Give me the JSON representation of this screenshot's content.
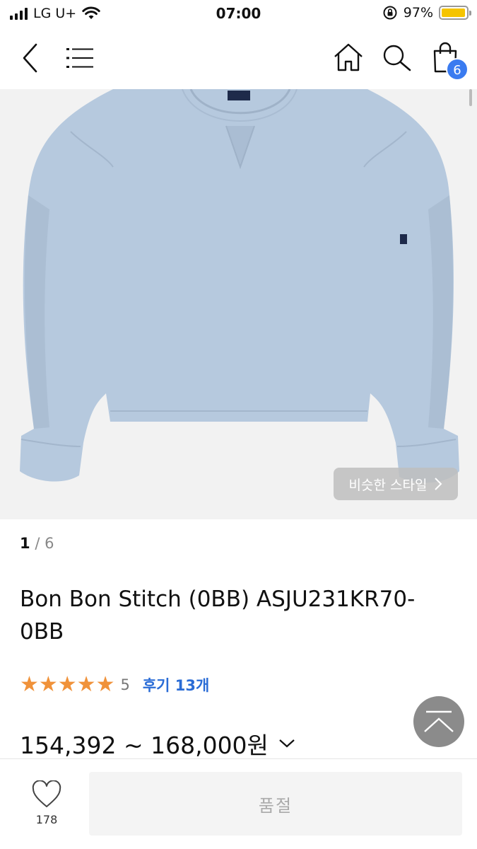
{
  "status": {
    "carrier": "LG U+",
    "time": "07:00",
    "battery": "97%",
    "battery_level": 0.97
  },
  "nav": {
    "back_icon": "chevron-left-icon",
    "menu_icon": "hamburger-menu-icon",
    "home_icon": "home-icon",
    "search_icon": "search-icon",
    "cart_icon": "shopping-bag-icon",
    "cart_count": "6"
  },
  "gallery": {
    "current": "1",
    "separator": "/",
    "total": "6",
    "similar_style_label": "비슷한 스타일",
    "similar_style_icon": "chevron-right-icon",
    "image_bg_color": "#f2f2f2",
    "garment_color": "#b6c9de"
  },
  "product": {
    "name": "Bon Bon Stitch (0BB) ASJU231KR70-0BB",
    "stars": "★★★★★",
    "rating": "5",
    "review_link": "후기 13개",
    "price": "154,392 ~ 168,000원",
    "price_expand_icon": "chevron-down-icon"
  },
  "floating": {
    "scroll_top_icon": "scroll-to-top-icon"
  },
  "bottom": {
    "like_icon": "heart-icon",
    "like_count": "178",
    "soldout_label": "품절"
  },
  "colors": {
    "accent_blue": "#2a6cd6",
    "badge_blue": "#3a7bf0",
    "star_orange": "#f0923a",
    "battery_yellow": "#f5c400"
  }
}
